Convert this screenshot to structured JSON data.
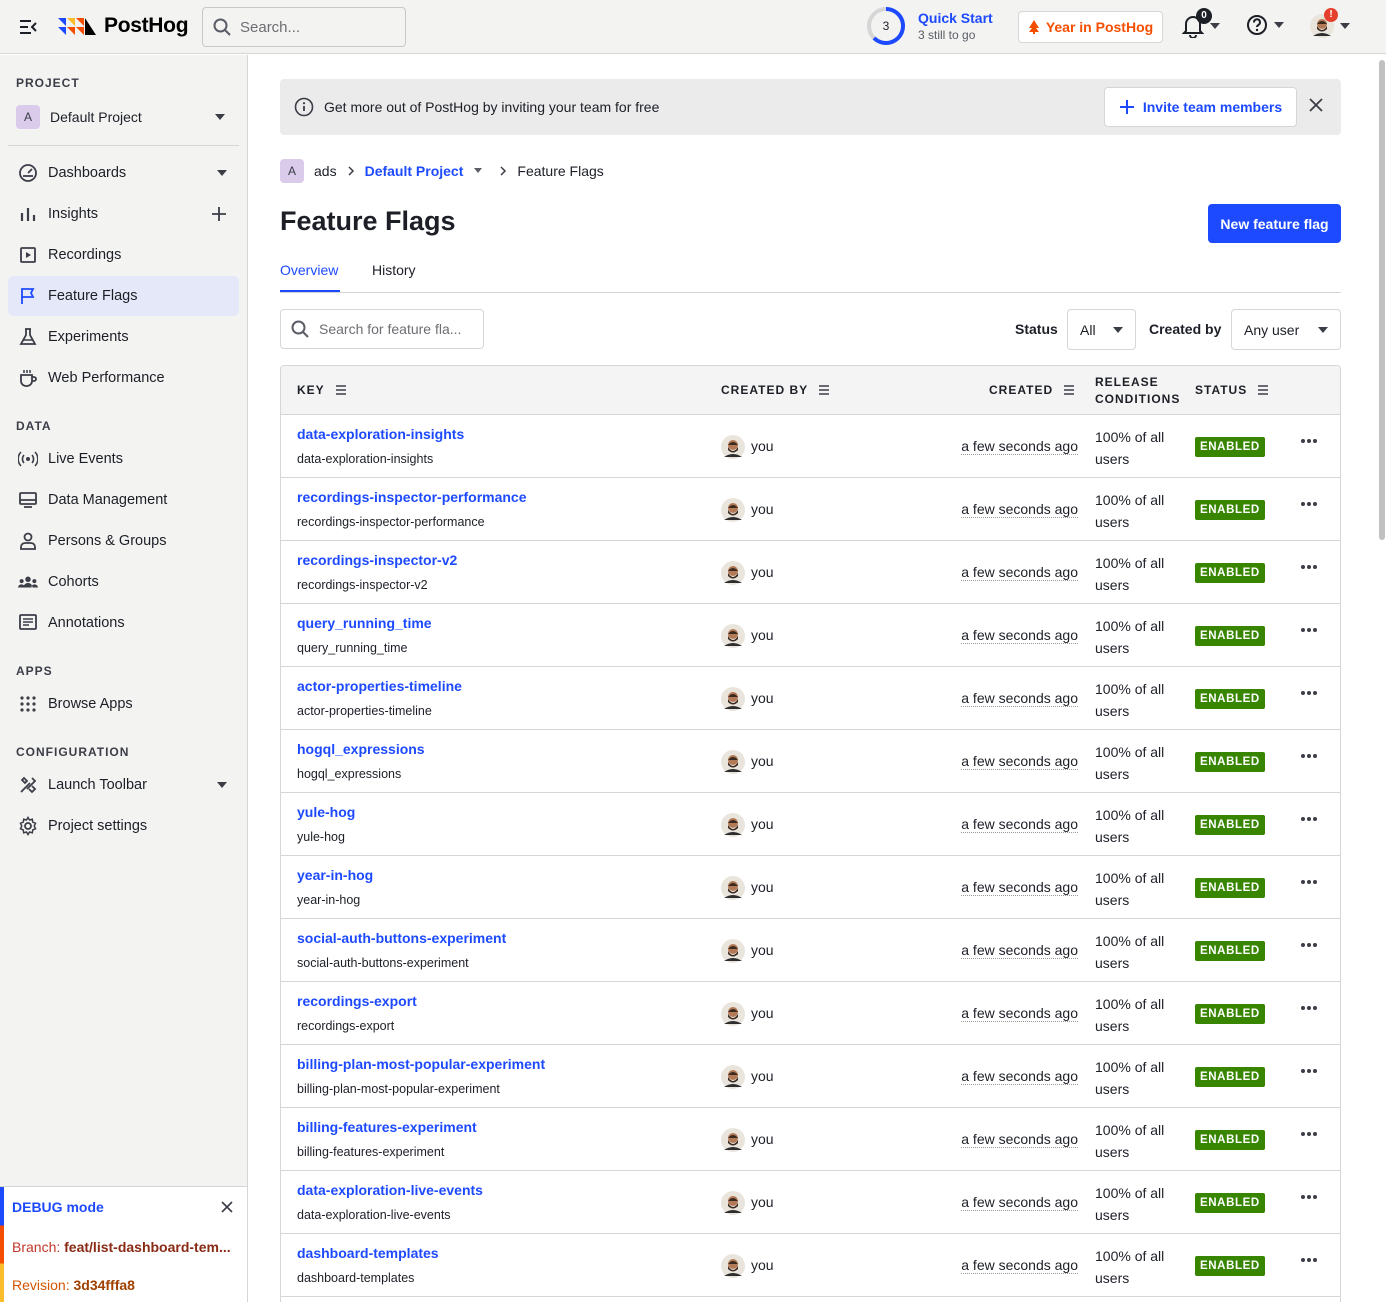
{
  "topbar": {
    "brand": "PostHog",
    "search_placeholder": "Search...",
    "quickstart": {
      "count": "3",
      "title": "Quick Start",
      "subtitle": "3 still to go"
    },
    "year_button": "Year in PostHog",
    "notifications_count": "0",
    "help_icon": "help-circle-icon",
    "profile_alert": "!"
  },
  "sidebar": {
    "project_label": "PROJECT",
    "project_initial": "A",
    "project_name": "Default Project",
    "nav": [
      {
        "label": "Dashboards",
        "icon": "dashboard-icon"
      },
      {
        "label": "Insights",
        "icon": "insights-icon"
      },
      {
        "label": "Recordings",
        "icon": "recordings-icon"
      },
      {
        "label": "Feature Flags",
        "icon": "flag-icon"
      },
      {
        "label": "Experiments",
        "icon": "flask-icon"
      },
      {
        "label": "Web Performance",
        "icon": "coffee-icon"
      }
    ],
    "data_label": "DATA",
    "data_nav": [
      {
        "label": "Live Events",
        "icon": "live-icon"
      },
      {
        "label": "Data Management",
        "icon": "database-icon"
      },
      {
        "label": "Persons & Groups",
        "icon": "person-icon"
      },
      {
        "label": "Cohorts",
        "icon": "cohorts-icon"
      },
      {
        "label": "Annotations",
        "icon": "annotation-icon"
      }
    ],
    "apps_label": "APPS",
    "apps_nav": [
      {
        "label": "Browse Apps",
        "icon": "apps-grid-icon"
      }
    ],
    "config_label": "CONFIGURATION",
    "config_nav": [
      {
        "label": "Launch Toolbar",
        "icon": "tools-icon"
      },
      {
        "label": "Project settings",
        "icon": "gear-icon"
      }
    ],
    "debug": {
      "title": "DEBUG mode",
      "branch_label": "Branch:",
      "branch_value": "feat/list-dashboard-tem...",
      "revision_label": "Revision:",
      "revision_value": "3d34fffa8"
    }
  },
  "banner": {
    "text": "Get more out of PostHog by inviting your team for free",
    "invite_button": "Invite team members"
  },
  "breadcrumb": {
    "org_initial": "A",
    "org": "ads",
    "project": "Default Project",
    "current": "Feature Flags"
  },
  "page": {
    "title": "Feature Flags",
    "new_button": "New feature flag",
    "tabs": [
      "Overview",
      "History"
    ],
    "search_placeholder": "Search for feature fla...",
    "status_label": "Status",
    "status_value": "All",
    "created_by_label": "Created by",
    "created_by_value": "Any user"
  },
  "table": {
    "headers": {
      "key": "KEY",
      "created_by": "CREATED BY",
      "created": "CREATED",
      "release_line1": "RELEASE",
      "release_line2": "CONDITIONS",
      "status": "STATUS"
    },
    "rows": [
      {
        "key": "data-exploration-insights",
        "created_by": "you",
        "created": "a few seconds ago",
        "release_line1": "100% of all",
        "release_line2": "users",
        "status": "ENABLED"
      },
      {
        "key": "recordings-inspector-performance",
        "created_by": "you",
        "created": "a few seconds ago",
        "release_line1": "100% of all",
        "release_line2": "users",
        "status": "ENABLED"
      },
      {
        "key": "recordings-inspector-v2",
        "created_by": "you",
        "created": "a few seconds ago",
        "release_line1": "100% of all",
        "release_line2": "users",
        "status": "ENABLED"
      },
      {
        "key": "query_running_time",
        "created_by": "you",
        "created": "a few seconds ago",
        "release_line1": "100% of all",
        "release_line2": "users",
        "status": "ENABLED"
      },
      {
        "key": "actor-properties-timeline",
        "created_by": "you",
        "created": "a few seconds ago",
        "release_line1": "100% of all",
        "release_line2": "users",
        "status": "ENABLED"
      },
      {
        "key": "hogql_expressions",
        "created_by": "you",
        "created": "a few seconds ago",
        "release_line1": "100% of all",
        "release_line2": "users",
        "status": "ENABLED"
      },
      {
        "key": "yule-hog",
        "created_by": "you",
        "created": "a few seconds ago",
        "release_line1": "100% of all",
        "release_line2": "users",
        "status": "ENABLED"
      },
      {
        "key": "year-in-hog",
        "created_by": "you",
        "created": "a few seconds ago",
        "release_line1": "100% of all",
        "release_line2": "users",
        "status": "ENABLED"
      },
      {
        "key": "social-auth-buttons-experiment",
        "created_by": "you",
        "created": "a few seconds ago",
        "release_line1": "100% of all",
        "release_line2": "users",
        "status": "ENABLED"
      },
      {
        "key": "recordings-export",
        "created_by": "you",
        "created": "a few seconds ago",
        "release_line1": "100% of all",
        "release_line2": "users",
        "status": "ENABLED"
      },
      {
        "key": "billing-plan-most-popular-experiment",
        "created_by": "you",
        "created": "a few seconds ago",
        "release_line1": "100% of all",
        "release_line2": "users",
        "status": "ENABLED"
      },
      {
        "key": "billing-features-experiment",
        "created_by": "you",
        "created": "a few seconds ago",
        "release_line1": "100% of all",
        "release_line2": "users",
        "status": "ENABLED"
      },
      {
        "key": "data-exploration-live-events",
        "created_by": "you",
        "created": "a few seconds ago",
        "release_line1": "100% of all",
        "release_line2": "users",
        "status": "ENABLED"
      },
      {
        "key": "dashboard-templates",
        "created_by": "you",
        "created": "a few seconds ago",
        "release_line1": "100% of all",
        "release_line2": "users",
        "status": "ENABLED"
      }
    ]
  },
  "colors": {
    "accent": "#1d4aff",
    "enabled": "#388600",
    "brand_orange": "#f54e00"
  }
}
